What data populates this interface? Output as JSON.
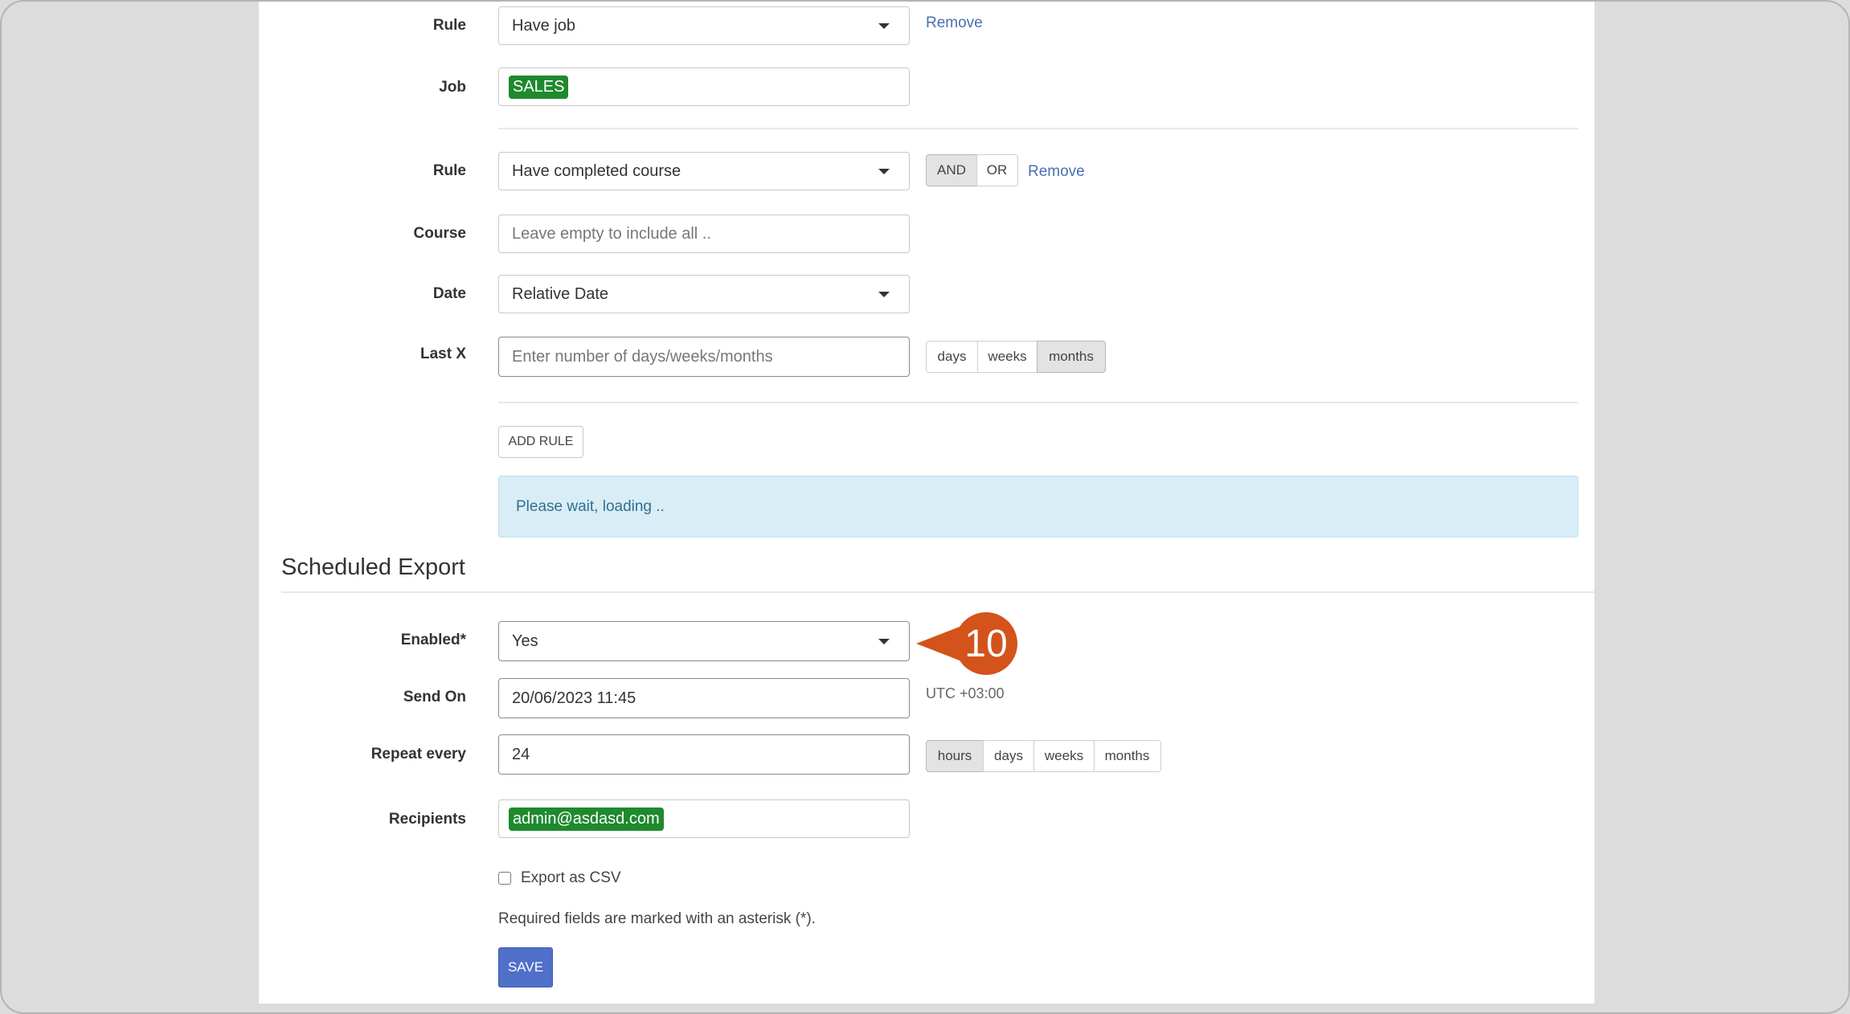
{
  "rules": {
    "rule1": {
      "label": "Rule",
      "value": "Have job",
      "remove": "Remove"
    },
    "job": {
      "label": "Job",
      "tag": "SALES"
    },
    "rule2": {
      "label": "Rule",
      "value": "Have completed course",
      "and": "AND",
      "or": "OR",
      "remove": "Remove"
    },
    "course": {
      "label": "Course",
      "placeholder": "Leave empty to include all .."
    },
    "date": {
      "label": "Date",
      "value": "Relative Date"
    },
    "lastx": {
      "label": "Last X",
      "placeholder": "Enter number of days/weeks/months",
      "units": [
        "days",
        "weeks",
        "months"
      ],
      "active": "months"
    },
    "add_rule": "ADD RULE",
    "loading": "Please wait, loading .."
  },
  "scheduled": {
    "title": "Scheduled Export",
    "enabled": {
      "label": "Enabled*",
      "value": "Yes"
    },
    "send_on": {
      "label": "Send On",
      "value": "20/06/2023 11:45",
      "tz": "UTC +03:00"
    },
    "repeat": {
      "label": "Repeat every",
      "value": "24",
      "units": [
        "hours",
        "days",
        "weeks",
        "months"
      ],
      "active": "hours"
    },
    "recipients": {
      "label": "Recipients",
      "tag": "admin@asdasd.com"
    },
    "export_csv": "Export as CSV",
    "required_note": "Required fields are marked with an asterisk (*).",
    "save": "SAVE"
  },
  "callout": {
    "number": "10",
    "color": "#d3531a"
  }
}
